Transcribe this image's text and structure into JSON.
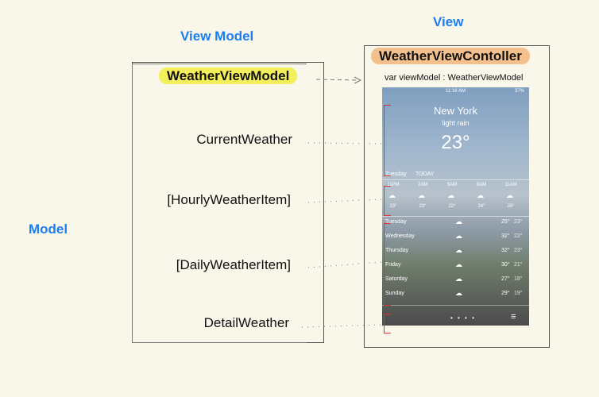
{
  "labels": {
    "view_model": "View Model",
    "view": "View",
    "model": "Model"
  },
  "view_model": {
    "title": "WeatherViewModel",
    "items": [
      "CurrentWeather",
      "[HourlyWeatherItem]",
      "[DailyWeatherItem]",
      "DetailWeather"
    ]
  },
  "view": {
    "title": "WeatherViewContoller",
    "var_line": "var viewModel : WeatherViewModel"
  },
  "phone": {
    "status_time": "11:16 AM",
    "status_battery": "37%",
    "city": "New York",
    "condition": "light rain",
    "temp": "23°",
    "day": "Tuesday",
    "today": "TODAY",
    "hours": [
      {
        "time": "11PM",
        "temp": "23°"
      },
      {
        "time": "2AM",
        "temp": "23°"
      },
      {
        "time": "5AM",
        "temp": "22°"
      },
      {
        "time": "8AM",
        "temp": "24°"
      },
      {
        "time": "11AM",
        "temp": "25°"
      }
    ],
    "days": [
      {
        "day": "Tuesday",
        "hi": "25°",
        "lo": "23°"
      },
      {
        "day": "Wednesday",
        "hi": "32°",
        "lo": "22°"
      },
      {
        "day": "Thursday",
        "hi": "32°",
        "lo": "23°"
      },
      {
        "day": "Friday",
        "hi": "30°",
        "lo": "21°"
      },
      {
        "day": "Saturday",
        "hi": "27°",
        "lo": "18°"
      },
      {
        "day": "Sunday",
        "hi": "29°",
        "lo": "19°"
      }
    ]
  },
  "colors": {
    "accent": "#1a7ff0",
    "highlight_yellow": "#f2ef5a",
    "highlight_orange": "#f4c08e",
    "bracket": "#e03030"
  }
}
